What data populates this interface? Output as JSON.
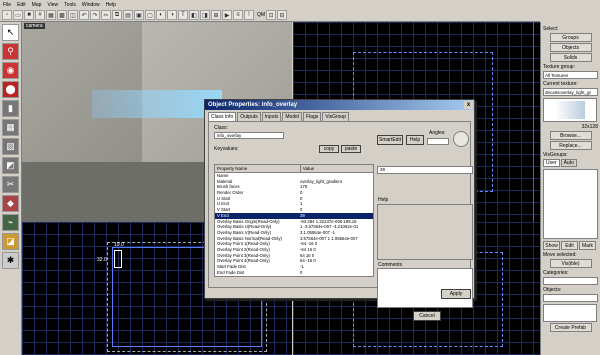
{
  "menubar": [
    "File",
    "Edit",
    "Map",
    "View",
    "Tools",
    "Window",
    "Help"
  ],
  "toolbar": {
    "label": "QM"
  },
  "viewports": {
    "camera_label": "camera"
  },
  "editor": {
    "sel_label_a": "10.0",
    "sel_label_b": "32.0"
  },
  "rightpanel": {
    "select_label": "Select:",
    "groups": "Groups",
    "objects": "Objects",
    "solids": "Solids",
    "texture_group_label": "Texture group:",
    "texture_group_value": "All Textures",
    "current_texture_label": "Current texture:",
    "current_texture_value": "decals/overlay_light_gr",
    "tex_size": "32x128",
    "browse": "Browse...",
    "replace": "Replace...",
    "visgroups_label": "VisGroups:",
    "user_tab": "User",
    "auto_tab": "Auto",
    "show": "Show",
    "edit": "Edit",
    "mark": "Mark",
    "move_selected": "Move selected:",
    "visgroup_btn": "Vis(ible)",
    "categories_label": "Categories:",
    "objects_label": "Objects:",
    "create_prefab": "Create Prefab"
  },
  "dialog": {
    "title": "Object Properties: info_overlay",
    "close": "x",
    "tabs": [
      "Class Info",
      "Outputs",
      "Inputs",
      "Model",
      "Flags",
      "VisGroup"
    ],
    "class_label": "Class:",
    "class_value": "info_overlay",
    "keyvalues_label": "Keyvalues:",
    "copy": "copy",
    "paste": "paste",
    "smartedit": "SmartEdit",
    "help": "Help",
    "angles_label": "Angles:",
    "value_field": "39",
    "help_label": "Help",
    "comments_label": "Comments",
    "cancel": "Cancel",
    "apply": "Apply",
    "col_name": "Property Name",
    "col_value": "Value",
    "rows": [
      {
        "k": "Name",
        "v": ""
      },
      {
        "k": "Material",
        "v": "overlay_light_gradient"
      },
      {
        "k": "Brush faces",
        "v": "178"
      },
      {
        "k": "Render Order",
        "v": "0"
      },
      {
        "k": "U Start",
        "v": "0"
      },
      {
        "k": "U End",
        "v": "1"
      },
      {
        "k": "V Start",
        "v": "0"
      },
      {
        "k": "V End",
        "v": "39"
      },
      {
        "k": "Overlay Basis Origin(Read-Only)",
        "v": "-93.284 1.32237e-005 198.18"
      },
      {
        "k": "Overlay Basis U(Read-Only)",
        "v": "1 -3.57564e-007 -4.21062e-01"
      },
      {
        "k": "Overlay Basis V(Read-Only)",
        "v": "3.1.05564e-007 -1"
      },
      {
        "k": "Overlay Basis Normal(Read-Only)",
        "v": "3.57564e-007 1 1.05564e-007"
      },
      {
        "k": "Overlay Point 1(Read-Only)",
        "v": "-64 -16 0"
      },
      {
        "k": "Overlay Point 2(Read-Only)",
        "v": "-64 16 0"
      },
      {
        "k": "Overlay Point 3(Read-Only)",
        "v": "64 16 0"
      },
      {
        "k": "Overlay Point 4(Read-Only)",
        "v": "64 -16 0"
      },
      {
        "k": "Start Fade Dist",
        "v": "-1"
      },
      {
        "k": "End Fade Dist",
        "v": "0"
      }
    ],
    "selected_row": 7
  }
}
